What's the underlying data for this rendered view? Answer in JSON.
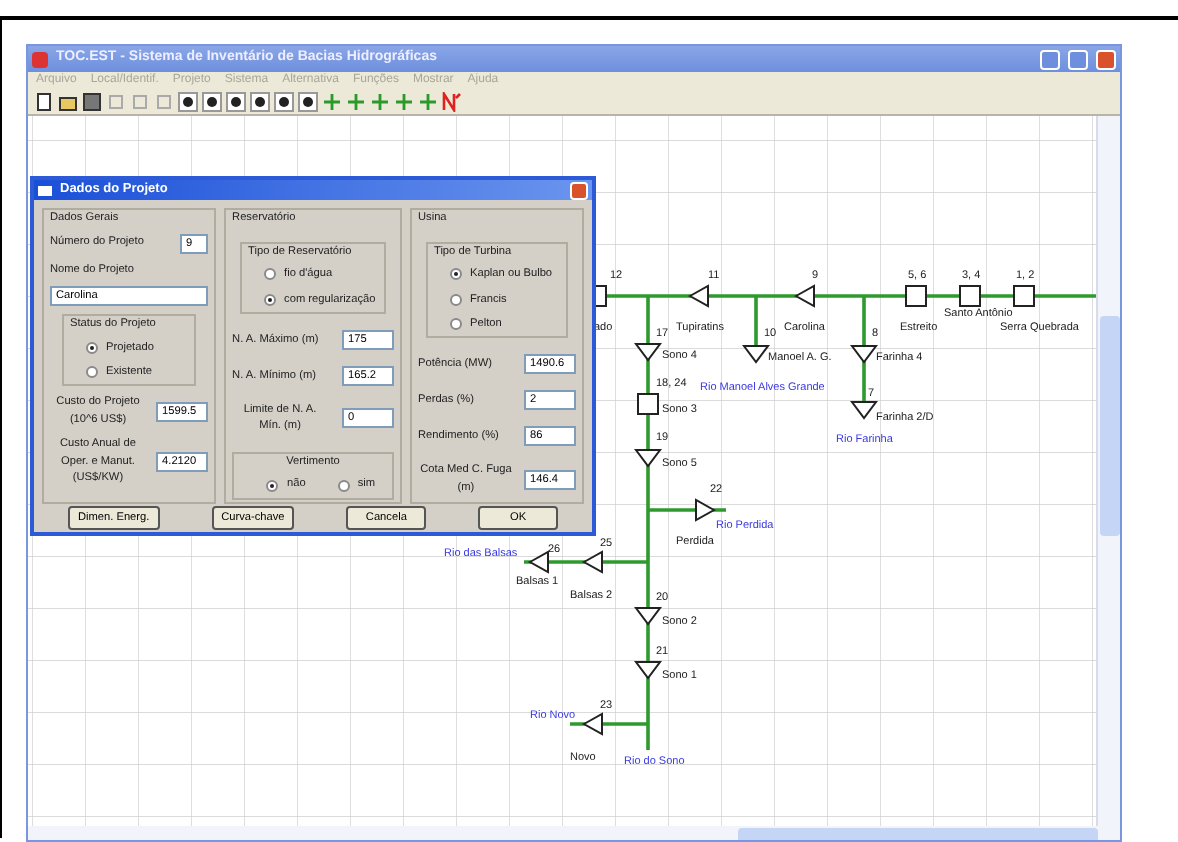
{
  "window": {
    "title": "TOC.EST - Sistema de Inventário de Bacias Hidrográficas"
  },
  "menu": [
    "Arquivo",
    "Local/Identif.",
    "Projeto",
    "Sistema",
    "Alternativa",
    "Funções",
    "Mostrar",
    "Ajuda"
  ],
  "diagram": {
    "nodes": [
      {
        "kind": "square",
        "number": "12",
        "name": "ado"
      },
      {
        "kind": "triangle-left",
        "number": "11",
        "name": "Tupiratins"
      },
      {
        "kind": "triangle-left",
        "number": "9",
        "name": "Carolina"
      },
      {
        "kind": "square",
        "number": "5, 6",
        "name": "Estreito"
      },
      {
        "kind": "square",
        "number": "3, 4",
        "name": "Santo Antônio"
      },
      {
        "kind": "square",
        "number": "1, 2",
        "name": "Serra Quebrada"
      },
      {
        "kind": "triangle-down",
        "number": "17",
        "name": "Sono 4"
      },
      {
        "kind": "triangle-down",
        "number": "10",
        "name": "Manoel A. G."
      },
      {
        "kind": "triangle-down",
        "number": "8",
        "name": "Farinha 4"
      },
      {
        "kind": "square",
        "number": "18, 24",
        "name": "Sono 3"
      },
      {
        "kind": "triangle-down",
        "number": "19",
        "name": "Sono 5"
      },
      {
        "kind": "triangle-right",
        "number": "22",
        "name": "Perdida"
      },
      {
        "kind": "triangle-left",
        "number": "26",
        "name": "Balsas 1"
      },
      {
        "kind": "triangle-left",
        "number": "25",
        "name": "Balsas 2"
      },
      {
        "kind": "triangle-down",
        "number": "20",
        "name": "Sono 2"
      },
      {
        "kind": "triangle-down",
        "number": "21",
        "name": "Sono 1"
      },
      {
        "kind": "triangle-left",
        "number": "23",
        "name": "Novo"
      },
      {
        "kind": "triangle-down",
        "number": "7",
        "name": "Farinha 2/D"
      }
    ],
    "rivers": [
      "Rio Manoel Alves Grande",
      "Rio Farinha",
      "Rio Perdida",
      "Rio das Balsas",
      "Rio Novo",
      "Rio do Sono"
    ]
  },
  "dialog": {
    "title": "Dados do Projeto",
    "general": {
      "legend": "Dados Gerais",
      "number": {
        "label": "Número do Projeto",
        "value": "9"
      },
      "name": {
        "label": "Nome do Projeto",
        "value": "Carolina"
      },
      "status": {
        "legend": "Status do Projeto",
        "options": [
          {
            "label": "Projetado",
            "selected": true
          },
          {
            "label": "Existente",
            "selected": false
          }
        ]
      },
      "cost": {
        "label": "Custo do Projeto (10^6 US$)",
        "value": "1599.5"
      },
      "annual": {
        "label": "Custo Anual de Oper. e Manut. (US$/KW)",
        "value": "4.2120"
      }
    },
    "reservoir": {
      "legend": "Reservatório",
      "type": {
        "legend": "Tipo de Reservatório",
        "options": [
          {
            "label": "fio d'água",
            "selected": false
          },
          {
            "label": "com regularização",
            "selected": true
          }
        ]
      },
      "fields": [
        {
          "label": "N. A. Máximo (m)",
          "value": "175"
        },
        {
          "label": "N. A. Mínimo (m)",
          "value": "165.2"
        },
        {
          "label": "Limite de N. A. Mín. (m)",
          "value": "0"
        }
      ],
      "spill": {
        "legend": "Vertimento",
        "options": [
          {
            "label": "não",
            "selected": true
          },
          {
            "label": "sim",
            "selected": false
          }
        ]
      }
    },
    "plant": {
      "legend": "Usina",
      "turbine": {
        "legend": "Tipo de Turbina",
        "options": [
          {
            "label": "Kaplan ou Bulbo",
            "selected": true
          },
          {
            "label": "Francis",
            "selected": false
          },
          {
            "label": "Pelton",
            "selected": false
          }
        ]
      },
      "fields": [
        {
          "label": "Potência (MW)",
          "value": "1490.6"
        },
        {
          "label": "Perdas (%)",
          "value": "2"
        },
        {
          "label": "Rendimento (%)",
          "value": "86"
        },
        {
          "label": "Cota Med C. Fuga (m)",
          "value": "146.4"
        }
      ]
    },
    "buttons": [
      "Dimen. Energ.",
      "Curva-chave",
      "Cancela",
      "OK"
    ]
  }
}
